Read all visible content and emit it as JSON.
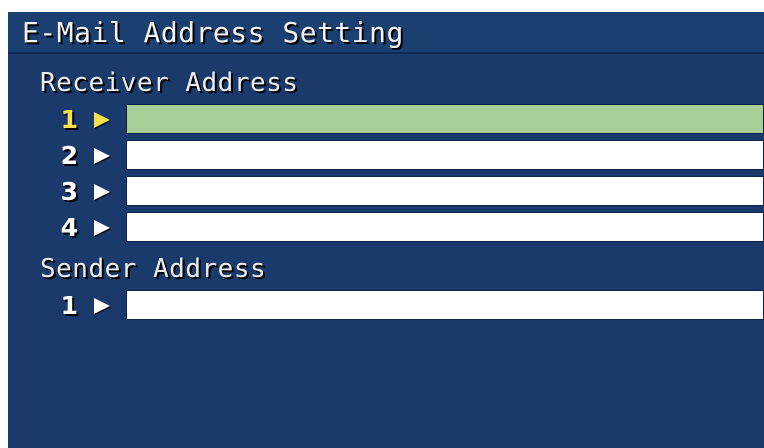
{
  "title": "E-Mail Address Setting",
  "receiver": {
    "label": "Receiver Address",
    "rows": [
      {
        "number": "1",
        "value": "",
        "selected": true
      },
      {
        "number": "2",
        "value": "",
        "selected": false
      },
      {
        "number": "3",
        "value": "",
        "selected": false
      },
      {
        "number": "4",
        "value": "",
        "selected": false
      }
    ]
  },
  "sender": {
    "label": "Sender Address",
    "rows": [
      {
        "number": "1",
        "value": "",
        "selected": false
      }
    ]
  },
  "colors": {
    "background": "#1a3a6b",
    "selected_field": "#a8cf98",
    "selected_marker": "#f4e04a",
    "field": "#ffffff"
  }
}
